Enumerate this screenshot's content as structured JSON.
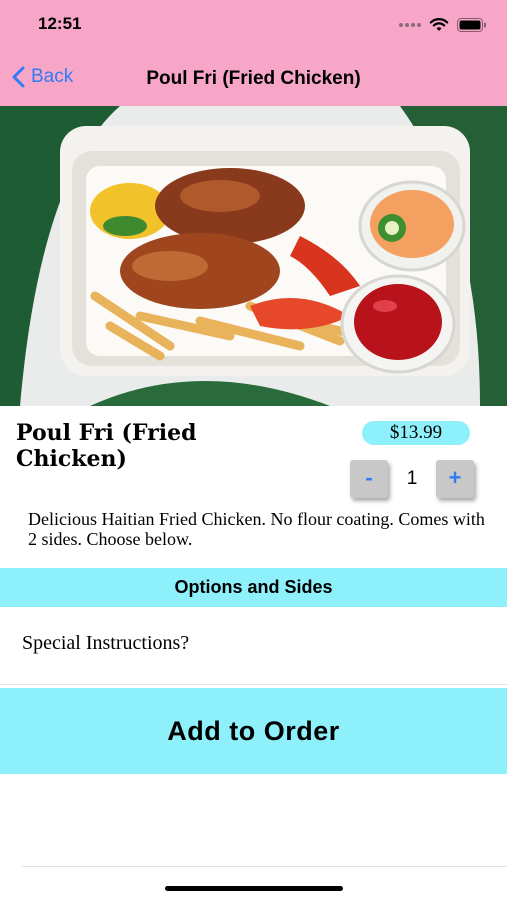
{
  "status_bar": {
    "time": "12:51"
  },
  "nav": {
    "back_label": "Back",
    "title": "Poul Fri (Fried Chicken)"
  },
  "item": {
    "name": "Poul Fri (Fried Chicken)",
    "price": "$13.99",
    "quantity": "1",
    "decrement_label": "-",
    "increment_label": "+",
    "description": "Delicious Haitian Fried Chicken. No flour coating. Comes with 2 sides. Choose below."
  },
  "options": {
    "header": "Options and Sides",
    "special_instructions": "Special Instructions?"
  },
  "actions": {
    "add_to_order": "Add to Order"
  },
  "colors": {
    "header_bg": "#f8a6c8",
    "accent_cyan": "#8ef0fa",
    "link_blue": "#2f7cf6"
  }
}
